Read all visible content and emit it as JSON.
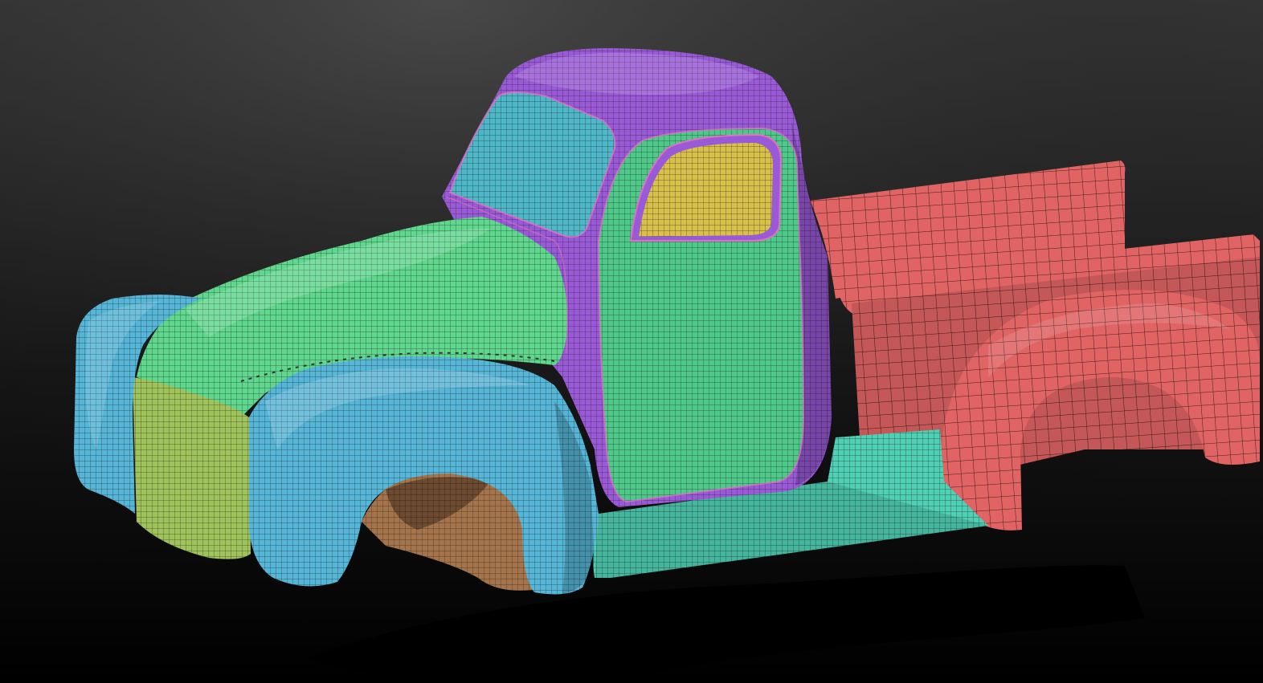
{
  "viewport": {
    "background": {
      "top_color": "#3e3e3e",
      "bottom_color": "#000000"
    },
    "polygroup_colors": {
      "fender": "#56b6d8",
      "grille_panel": "#9fc35a",
      "hood": "#5fd88e",
      "cab": "#9a5ad8",
      "windshield": "#4fb8c8",
      "door": "#4fc98a",
      "window": "#d8c04a",
      "running_board": "#4fcfb3",
      "bed": "#e06464",
      "wheel_well": "#a6744a"
    },
    "wireframe_color": "#1a1a1a",
    "shadow_color": "#000000"
  }
}
